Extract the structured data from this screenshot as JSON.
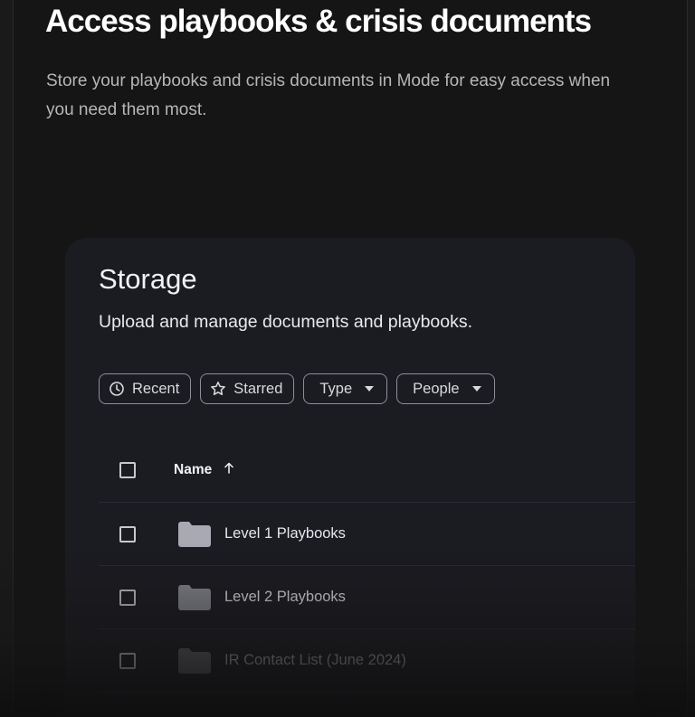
{
  "hero": {
    "title": "Access playbooks & crisis documents",
    "description": "Store your playbooks and crisis documents in Mode for easy access when you need them most."
  },
  "storage": {
    "title": "Storage",
    "subtitle": "Upload and manage documents and playbooks.",
    "filters": [
      {
        "label": "Recent",
        "icon": "clock-icon"
      },
      {
        "label": "Starred",
        "icon": "star-icon"
      },
      {
        "label": "Type",
        "icon": "caret-down-icon"
      },
      {
        "label": "People",
        "icon": "caret-down-icon"
      }
    ],
    "table": {
      "name_header": "Name",
      "sort_icon": "arrow-up-icon",
      "rows": [
        {
          "name": "Level 1 Playbooks",
          "icon": "folder-icon"
        },
        {
          "name": "Level 2 Playbooks",
          "icon": "folder-icon"
        },
        {
          "name": "IR Contact List (June 2024)",
          "icon": "folder-icon"
        }
      ]
    }
  },
  "colors": {
    "page_background": "#151515",
    "card_background": "#1b1b22",
    "border": "#8e8e98",
    "folder": "#a9a9b3"
  }
}
